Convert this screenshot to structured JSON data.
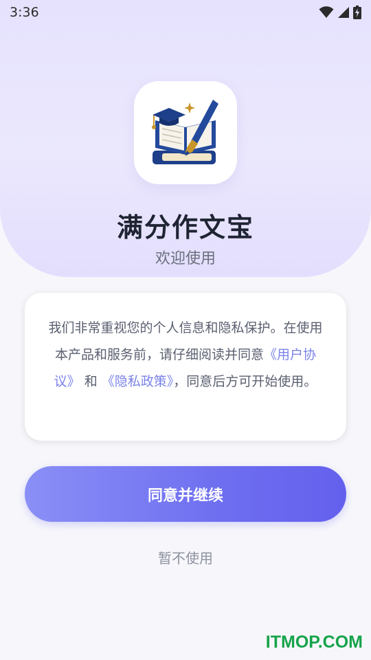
{
  "status_bar": {
    "time": "3:36",
    "icons": [
      "wifi-icon",
      "cellular-signal-icon",
      "battery-charging-icon"
    ]
  },
  "app": {
    "name": "满分作文宝",
    "welcome": "欢迎使用",
    "icon": "book-graduation-cap-brush-logo"
  },
  "notice": {
    "text_before": "我们非常重视您的个人信息和隐私保护。在使用本产品和服务前，请仔细阅读并同意",
    "user_agreement_link": "《用户协议》",
    "conjunction": " 和 ",
    "privacy_policy_link": "《隐私政策》",
    "text_after": "，同意后方可开始使用。"
  },
  "buttons": {
    "agree_label": "同意并继续",
    "decline_label": "暂不使用"
  },
  "watermark": "ITMOP.COM",
  "colors": {
    "accent": "#6e6ff0",
    "link": "#7b83e8",
    "hero_bg": "#e6e2fe",
    "watermark": "#16a34a"
  }
}
